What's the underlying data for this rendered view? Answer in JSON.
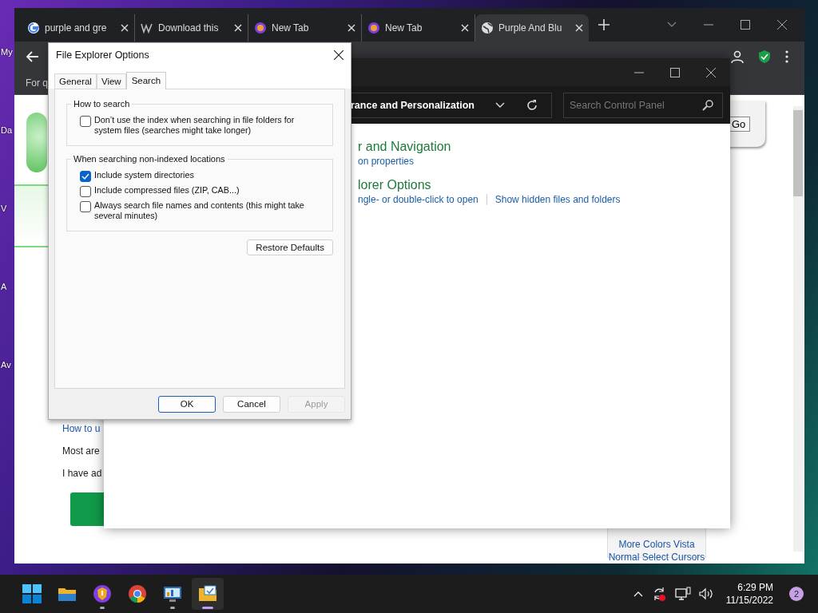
{
  "desktop": {
    "icons": [
      {
        "label": "My"
      },
      {
        "label": "Da"
      },
      {
        "label": "V"
      },
      {
        "label": "A"
      },
      {
        "label": "Av"
      }
    ]
  },
  "browser": {
    "tabs": [
      {
        "title": "purple and gre",
        "kind": "google",
        "selected": false
      },
      {
        "title": "Download this",
        "kind": "w",
        "selected": false
      },
      {
        "title": "New Tab",
        "kind": "brave",
        "selected": false
      },
      {
        "title": "New Tab",
        "kind": "brave",
        "selected": false
      },
      {
        "title": "Purple And Blu",
        "kind": "globe",
        "selected": true
      }
    ],
    "bookmark": "For q",
    "page": {
      "go_button": "Go",
      "link": "How to u",
      "paragraphs": [
        "Most are",
        "I have ad"
      ],
      "side_links": [
        "More Colors Vista",
        "Normal Select Cursors"
      ]
    }
  },
  "control_panel": {
    "address": "rance and Personalization",
    "search": {
      "placeholder": "Search Control Panel"
    },
    "sections": [
      {
        "heading": "r and Navigation",
        "links": [
          "on properties"
        ]
      },
      {
        "heading": "lorer Options",
        "links": [
          "ngle- or double-click to open",
          "Show hidden files and folders"
        ]
      }
    ]
  },
  "dialog": {
    "title": "File Explorer Options",
    "tabs": [
      {
        "label": "General",
        "selected": false
      },
      {
        "label": "View",
        "selected": false
      },
      {
        "label": "Search",
        "selected": true
      }
    ],
    "groups": [
      {
        "title": "How to search",
        "options": [
          {
            "label": "Don’t use the index when searching in file folders for system files (searches might take longer)",
            "checked": false
          }
        ]
      },
      {
        "title": "When searching non-indexed locations",
        "options": [
          {
            "label": "Include system directories",
            "checked": true
          },
          {
            "label": "Include compressed files (ZIP, CAB...)",
            "checked": false
          },
          {
            "label": "Always search file names and contents (this might take several minutes)",
            "checked": false
          }
        ]
      }
    ],
    "restore_button": "Restore Defaults",
    "buttons": [
      {
        "label": "OK",
        "kind": "default",
        "disabled": false
      },
      {
        "label": "Cancel",
        "kind": "normal",
        "disabled": false
      },
      {
        "label": "Apply",
        "kind": "normal",
        "disabled": true
      }
    ]
  },
  "taskbar": {
    "apps": [
      {
        "kind": "start",
        "running": false,
        "active": false
      },
      {
        "kind": "folder",
        "running": false,
        "active": false
      },
      {
        "kind": "brave",
        "running": true,
        "active": false
      },
      {
        "kind": "chrome",
        "running": false,
        "active": false
      },
      {
        "kind": "control",
        "running": true,
        "active": false
      },
      {
        "kind": "explorer",
        "running": true,
        "active": true
      }
    ],
    "time": "6:29 PM",
    "date": "11/15/2022",
    "notifications": "2"
  }
}
